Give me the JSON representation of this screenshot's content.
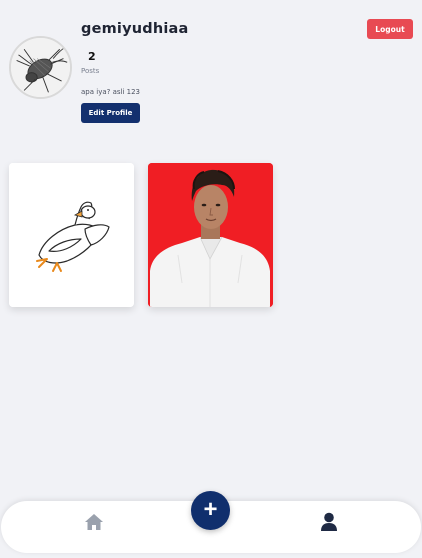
{
  "profile": {
    "username": "gemiyudhiaa",
    "post_count": "2",
    "posts_label": "Posts",
    "bio": "apa iya? asli 123",
    "edit_label": "Edit Profile",
    "logout_label": "Logout",
    "avatar_icon": "insect-sketch-avatar"
  },
  "posts": [
    {
      "image": "goose-illustration",
      "background": "#ffffff"
    },
    {
      "image": "portrait-photo",
      "background": "#f01e24"
    }
  ],
  "bottom_nav": {
    "items": [
      {
        "icon": "home-icon",
        "active": false
      },
      {
        "icon": "add-icon",
        "symbol": "+"
      },
      {
        "icon": "user-icon",
        "active": true
      }
    ]
  },
  "colors": {
    "primary": "#13306e",
    "danger": "#e84a53",
    "background": "#f1f2f6",
    "nav_inactive": "#9aa1ad",
    "nav_active": "#1f2a44"
  }
}
